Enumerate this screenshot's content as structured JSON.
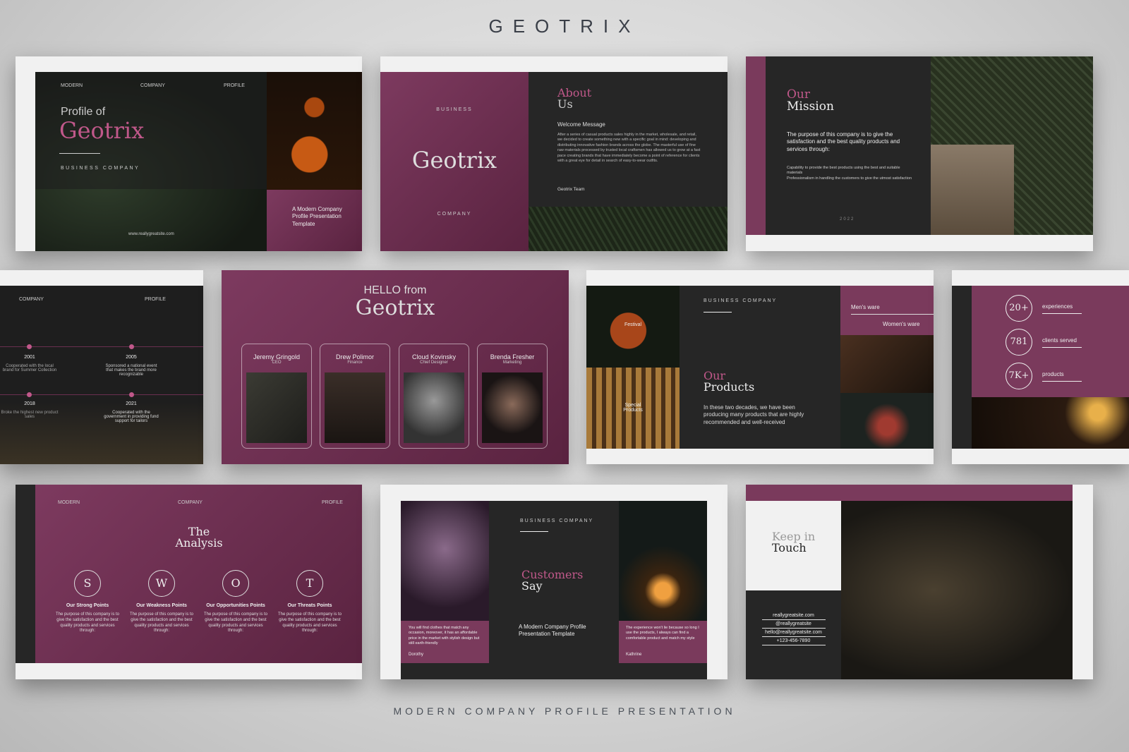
{
  "brand": "GEOTRIX",
  "footer": "MODERN COMPANY PROFILE PRESENTATION",
  "colors": {
    "accent": "#7a3a5c",
    "accent_text": "#c0588a",
    "dark": "#262626"
  },
  "slide1": {
    "nav": [
      "MODERN",
      "COMPANY",
      "PROFILE"
    ],
    "title_top": "Profile of",
    "title": "Geotrix",
    "subtitle": "BUSINESS COMPANY",
    "website": "www.reallygreatsite.com",
    "tagline": "A Modern Company Profile Presentation Template"
  },
  "slide2": {
    "top": "BUSINESS",
    "name": "Geotrix",
    "bottom": "COMPANY",
    "title_top": "About",
    "title": "Us",
    "heading": "Welcome Message",
    "body": "After a series of casual products sales highly in the market, wholesale, and retail, we decided to create something new with a specific goal in mind: developing and distributing innovative fashion brands across the globe. The masterful use of fine raw materials processed by trusted local craftsmen has allowed us to grow at a fast pace creating brands that have immediately become a point of reference for clients with a great eye for detail in search of easy-to-wear outfits.",
    "sign": "Geotrix Team"
  },
  "slide3": {
    "title_top": "Our",
    "title": "Mission",
    "lead": "The purpose of this company is to give the satisfaction and the best quality products and services through:",
    "points": "Capability to provide the best products using the best and suitable materials\nProfessionalism in handling the customers to give the utmost satisfaction",
    "year": "2022"
  },
  "slide4": {
    "nav": [
      "COMPANY",
      "PROFILE"
    ],
    "events": [
      {
        "year": "2001",
        "text": "Cooperated with the local brand for Summer Collection"
      },
      {
        "year": "2005",
        "text": "Sponsored a national event that makes the brand more recognizable"
      },
      {
        "year": "2018",
        "text": "Broke the highest new product sales"
      },
      {
        "year": "2021",
        "text": "Cooperated with the government in providing fund support for tailors"
      }
    ]
  },
  "slide5": {
    "title_top": "HELLO from",
    "title": "Geotrix",
    "team": [
      {
        "name": "Jeremy Gringold",
        "role": "CEO"
      },
      {
        "name": "Drew Polimor",
        "role": "Finance"
      },
      {
        "name": "Cloud Kovinsky",
        "role": "Chief Designer"
      },
      {
        "name": "Brenda Fresher",
        "role": "Marketing"
      }
    ]
  },
  "slide6": {
    "label": "BUSINESS COMPANY",
    "title_top": "Our",
    "title": "Products",
    "body": "In these two decades, we have been producing many products that are highly recommended and well-received",
    "photo_labels": [
      "Festival",
      "Special Products"
    ],
    "tabs": [
      "Men's ware",
      "Women's ware"
    ]
  },
  "slide7": {
    "stats": [
      {
        "value": "20+",
        "label": "experiences"
      },
      {
        "value": "781",
        "label": "clients served"
      },
      {
        "value": "7K+",
        "label": "products"
      }
    ]
  },
  "slide8": {
    "nav": [
      "MODERN",
      "COMPANY",
      "PROFILE"
    ],
    "title_top": "The",
    "title": "Analysis",
    "items": [
      {
        "letter": "S",
        "title": "Our Strong Points",
        "text": "The purpose of this company is to give the satisfaction and the best quality products and services through:"
      },
      {
        "letter": "W",
        "title": "Our Weakness Points",
        "text": "The purpose of this company is to give the satisfaction and the best quality products and services through:"
      },
      {
        "letter": "O",
        "title": "Our Opportunities Points",
        "text": "The purpose of this company is to give the satisfaction and the best quality products and services through:"
      },
      {
        "letter": "T",
        "title": "Our Threats Points",
        "text": "The purpose of this company is to give the satisfaction and the best quality products and services through:"
      }
    ]
  },
  "slide9": {
    "label": "BUSINESS COMPANY",
    "title_top": "Customers",
    "title": "Say",
    "tagline": "A Modern Company Profile Presentation Template",
    "quotes": [
      {
        "text": "You will find clothes that match any occasion, moreover, it has an affordable price in the market with stylish design but still earth-friendly",
        "name": "Dorothy"
      },
      {
        "text": "The experience won't lie because so long I use the products, I always can find a comfortable product and match my style",
        "name": "Kathrine"
      }
    ]
  },
  "slide10": {
    "title_top": "Keep in",
    "title": "Touch",
    "contacts": [
      "reallygreatsite.com",
      "@reallygreatsite",
      "hello@reallygreatsite.com",
      "+123-456-7890"
    ]
  }
}
